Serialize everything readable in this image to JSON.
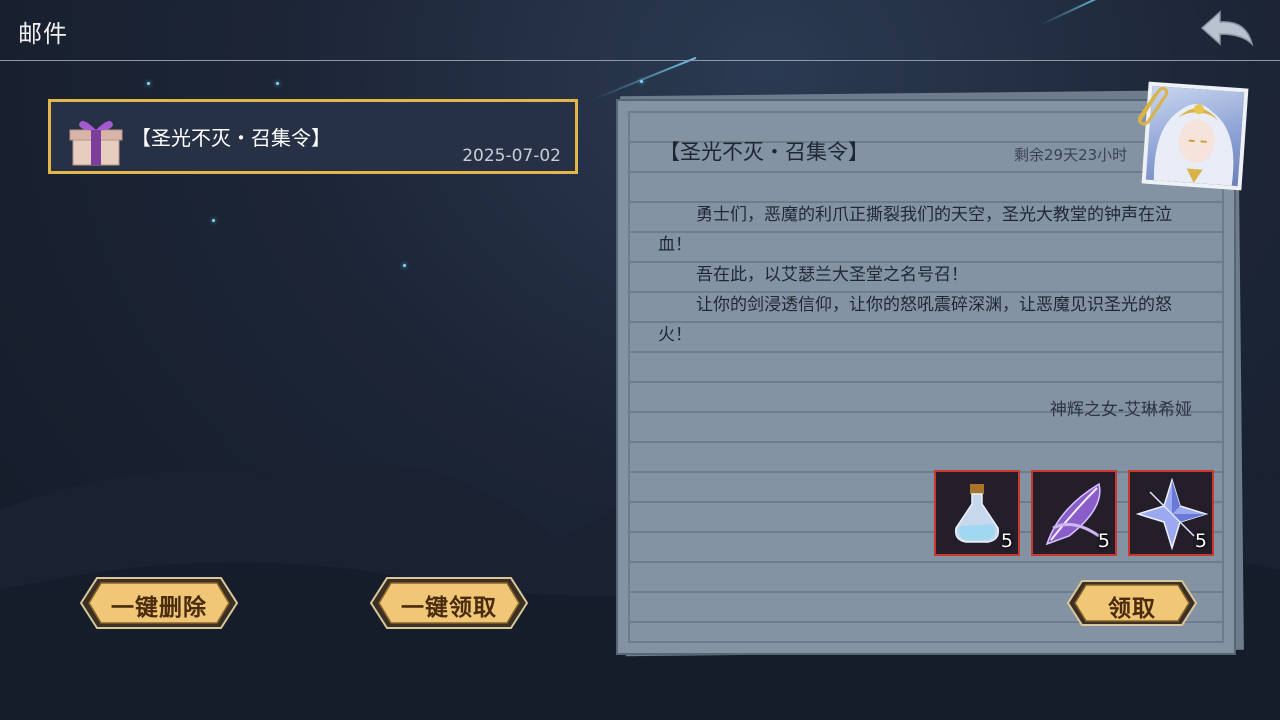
{
  "header": {
    "title": "邮件",
    "back_icon": "back-arrow-icon"
  },
  "mail_list": [
    {
      "subject": "【圣光不灭・召集令】",
      "date": "2025-07-02",
      "icon": "gift-box-icon",
      "selected": true
    }
  ],
  "buttons": {
    "delete_all": "一键删除",
    "claim_all": "一键领取",
    "claim": "领取"
  },
  "letter": {
    "title": "【圣光不灭・召集令】",
    "remaining": "剩余29天23小时",
    "body": [
      "勇士们，恶魔的利爪正撕裂我们的天空，圣光大教堂的钟声在泣血！",
      "吾在此，以艾瑟兰大圣堂之名号召！",
      "让你的剑浸透信仰，让你的怒吼震碎深渊，让恶魔见识圣光的怒火！"
    ],
    "signature": "神辉之女-艾琳希娅"
  },
  "rewards": [
    {
      "icon": "potion-bottle-icon",
      "count": "5"
    },
    {
      "icon": "purple-feather-icon",
      "count": "5"
    },
    {
      "icon": "crystal-star-icon",
      "count": "5"
    }
  ],
  "colors": {
    "selected_border": "#e2b64a",
    "button_gold": "#f0c777",
    "reward_border": "#c93a2c",
    "paper": "#8493a3"
  }
}
